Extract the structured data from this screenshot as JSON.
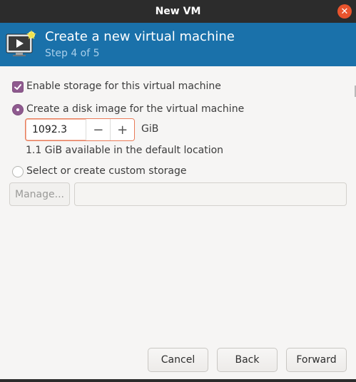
{
  "window": {
    "title": "New VM",
    "close_icon": "close-icon"
  },
  "header": {
    "title": "Create a new virtual machine",
    "step": "Step 4 of 5",
    "icon": "vm-display-icon",
    "background_color": "#1a71aa"
  },
  "storage": {
    "enable_label": "Enable storage for this virtual machine",
    "enable_checked": true,
    "create_disk_label": "Create a disk image for the virtual machine",
    "create_disk_selected": true,
    "disk_size_value": "1092.3",
    "decrement_symbol": "−",
    "increment_symbol": "+",
    "unit": "GiB",
    "available_text": "1.1 GiB available in the default location",
    "custom_label": "Select or create custom storage",
    "custom_selected": false,
    "manage_label": "Manage...",
    "path_value": ""
  },
  "footer": {
    "cancel_label": "Cancel",
    "back_label": "Back",
    "forward_label": "Forward"
  },
  "colors": {
    "accent": "#8f5a8f",
    "focus": "#e97b58",
    "titlebar": "#2c2c2c"
  }
}
